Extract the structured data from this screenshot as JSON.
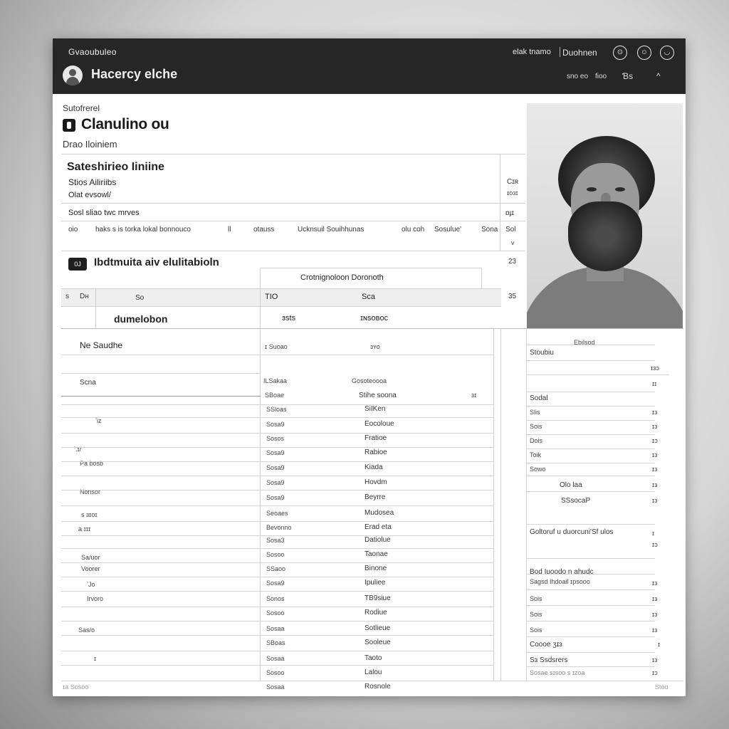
{
  "header": {
    "app_name": "Gvaoubuleo",
    "title": "Hacercy elche",
    "link_left": "elak tnamo",
    "link_right": "Duohnen",
    "icon_btn_1": "⊙",
    "icon_btn_2": "☺",
    "icon_btn_3": "◡",
    "sub_1": "sno eo",
    "sub_2": "fioo",
    "sub_3": "Ɓs",
    "caret": "^"
  },
  "page": {
    "breadcrumb": "Sutofrerel",
    "title": "Clanulino ou",
    "subtitle": "Drao Iloiniem"
  },
  "summary": {
    "heading": "Sateshirieo Iiniine",
    "line_1": "Stios Ailiriibs",
    "line_2": "Olat evsowl/",
    "side_1": "Cɪʀ",
    "side_2": "ɪoɜɪ",
    "line_3": "Sosl sliao twc mrves",
    "side_3": "ɒɟɪ",
    "row_cells": [
      "oio",
      "haks s is torka lokal bonnouco",
      "ll",
      "otauss",
      "Ucknsuil Souihhunas",
      "olu coh",
      "Sosulue'",
      "Sona",
      "Sol"
    ],
    "row_side": "v"
  },
  "section": {
    "badge": "0J",
    "title": "Ibdtmuita aiv elulitabioln",
    "count": "23",
    "sub_head": "Crotnignoloon Doronoth",
    "gray_cells": [
      "s",
      "Dʜ",
      "So",
      "TIO",
      "Sca",
      "35"
    ],
    "label_row": [
      "dumelobon",
      "ɜsts",
      "ɪɴsoʙoc"
    ]
  },
  "main_table": {
    "left_labels": [
      "Ne Saudhe",
      "Scna",
      "ʼiz",
      "ʼ.ɪ/",
      "Pa bosb",
      "Nonsor",
      "s ɜɪoɪ",
      "a ɪɪɪ",
      "Sa/uor",
      "Voorer",
      "ʼJo",
      "Irvoro",
      "Sas/o",
      "ɪ"
    ],
    "col1_header": "ɪ Suoao",
    "col2_header": "ɜʏo",
    "col1": [
      "ILSakaa",
      "SBoae",
      "SSloas",
      "Sosa9",
      "Sosos",
      "Sosa9",
      "Sosa9",
      "Sosa9",
      "Sosa9",
      "Seoaes",
      "Bevonno",
      "Sosa3",
      "Sosoo",
      "SSaoo",
      "Sosa9",
      "Sonos",
      "Sosoo",
      "Sosaa",
      "SBoas",
      "Sosaa",
      "Sosoo",
      "Sosaa"
    ],
    "col2": [
      "Gosoteoooa",
      "Stihe soona",
      "SiIKen",
      "Eocoloue",
      "Fratioe",
      "Rabioe",
      "Kiada",
      "Hovdm",
      "Beyrre",
      "Mudosea",
      "Erad eta",
      "Datiolue",
      "Taonae",
      "Binone",
      "Ipuliee",
      "TB9siue",
      "Rodiue",
      "Sotlieue",
      "Sooleue",
      "Taoto",
      "Lalou",
      "Rosnole"
    ],
    "col3_mark": "ɜɪ",
    "footer_left": "Sosaon"
  },
  "right_panel": {
    "head": "Ebilsod",
    "sub": "Stoubiu",
    "items": [
      {
        "label": "",
        "value": "ɪɜɔ"
      },
      {
        "label": "",
        "value": "ɪɪ"
      },
      {
        "label": "Sodal",
        "value": ""
      },
      {
        "label": "Slis",
        "value": "ɪɜ"
      },
      {
        "label": "Sois",
        "value": "ɪɜ"
      },
      {
        "label": "Dois",
        "value": "ɪɔ"
      },
      {
        "label": "Toik",
        "value": "ɪɜ"
      },
      {
        "label": "Sowo",
        "value": "ɪɜ"
      },
      {
        "label": "Olo laa",
        "value": "ɪɜ"
      },
      {
        "label": "SSsocaP",
        "value": "ɪɜ"
      },
      {
        "label": "Goltoruf u duorcuni'Sf ulos",
        "value": "ɪ"
      },
      {
        "label": "",
        "value": "ɪɔ"
      },
      {
        "label": "Bod Iuoodo n ahudc",
        "value": ""
      },
      {
        "label": "Sagsd Ihdoail ɪpsooo",
        "value": "ɪɜ"
      },
      {
        "label": "Sois",
        "value": "ɪɜ"
      },
      {
        "label": "Sois",
        "value": "ɪɜ"
      },
      {
        "label": "Sois",
        "value": "ɪɜ"
      },
      {
        "label": "Coooe ʒɪɜ",
        "value": "ɪ"
      },
      {
        "label": "Sɜ Ssdsrers",
        "value": "ɪɜ"
      },
      {
        "label": "Sosae sɪsoo s ɪzoa",
        "value": "ɪɔ"
      }
    ],
    "footer": "Stoɑ"
  },
  "footer": {
    "left": "ɪa Sosoo"
  }
}
